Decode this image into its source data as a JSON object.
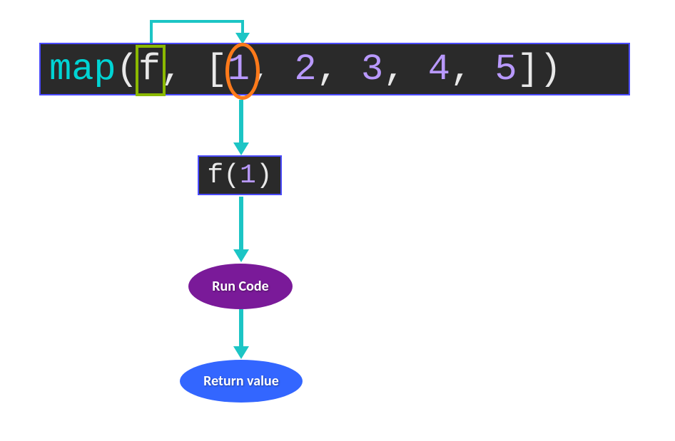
{
  "main_code": {
    "func_name": "map",
    "paren_open": "(",
    "arg_f": "f",
    "comma1": ",",
    "space1": " ",
    "bracket_open": "[",
    "n1": "1",
    "comma2": ",",
    "n2": "2",
    "comma3": ",",
    "n3": "3",
    "comma4": ",",
    "n4": "4",
    "comma5": ",",
    "n5": "5",
    "bracket_close": "]",
    "paren_close": ")"
  },
  "call_code": {
    "f": "f",
    "paren_open": "(",
    "arg": "1",
    "paren_close": ")"
  },
  "nodes": {
    "run_code": "Run Code",
    "return_value": "Return value"
  },
  "colors": {
    "code_bg": "#2a2a2a",
    "code_border": "#4a4aff",
    "cyan": "#00d4d4",
    "white": "#e8e8e8",
    "purple": "#b999ff",
    "green_highlight": "#8bb900",
    "orange_highlight": "#ff7a1a",
    "arrow": "#1cc5c5",
    "run_code_bg": "#7a1a99",
    "return_value_bg": "#3366ff"
  }
}
